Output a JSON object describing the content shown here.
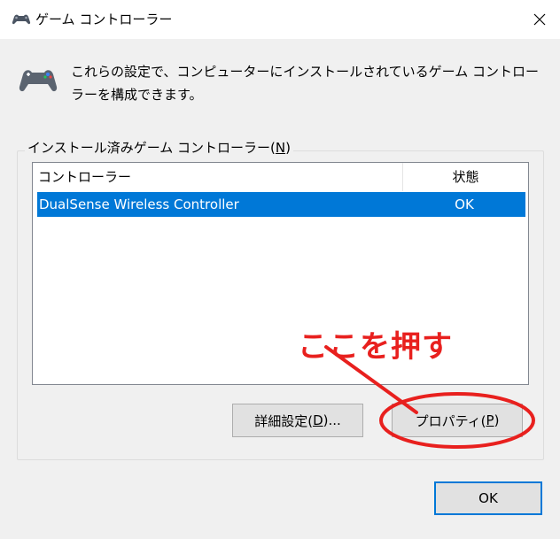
{
  "window": {
    "title": "ゲーム コントローラー",
    "close_icon": "close-icon"
  },
  "intro": {
    "text": "これらの設定で、コンピューターにインストールされているゲーム コントローラーを構成できます。"
  },
  "group": {
    "label_prefix": "インストール済みゲーム コントローラー(",
    "label_accel": "N",
    "label_suffix": ")"
  },
  "list": {
    "columns": [
      "コントローラー",
      "状態"
    ],
    "rows": [
      {
        "name": "DualSense Wireless Controller",
        "status": "OK",
        "selected": true
      }
    ],
    "selection_color": "#0078d7"
  },
  "buttons": {
    "advanced_prefix": "詳細設定(",
    "advanced_accel": "D",
    "advanced_suffix": ")...",
    "properties_prefix": "プロパティ(",
    "properties_accel": "P",
    "properties_suffix": ")",
    "ok": "OK"
  },
  "annotation": {
    "text": "ここを押す",
    "color": "#e8201e"
  }
}
